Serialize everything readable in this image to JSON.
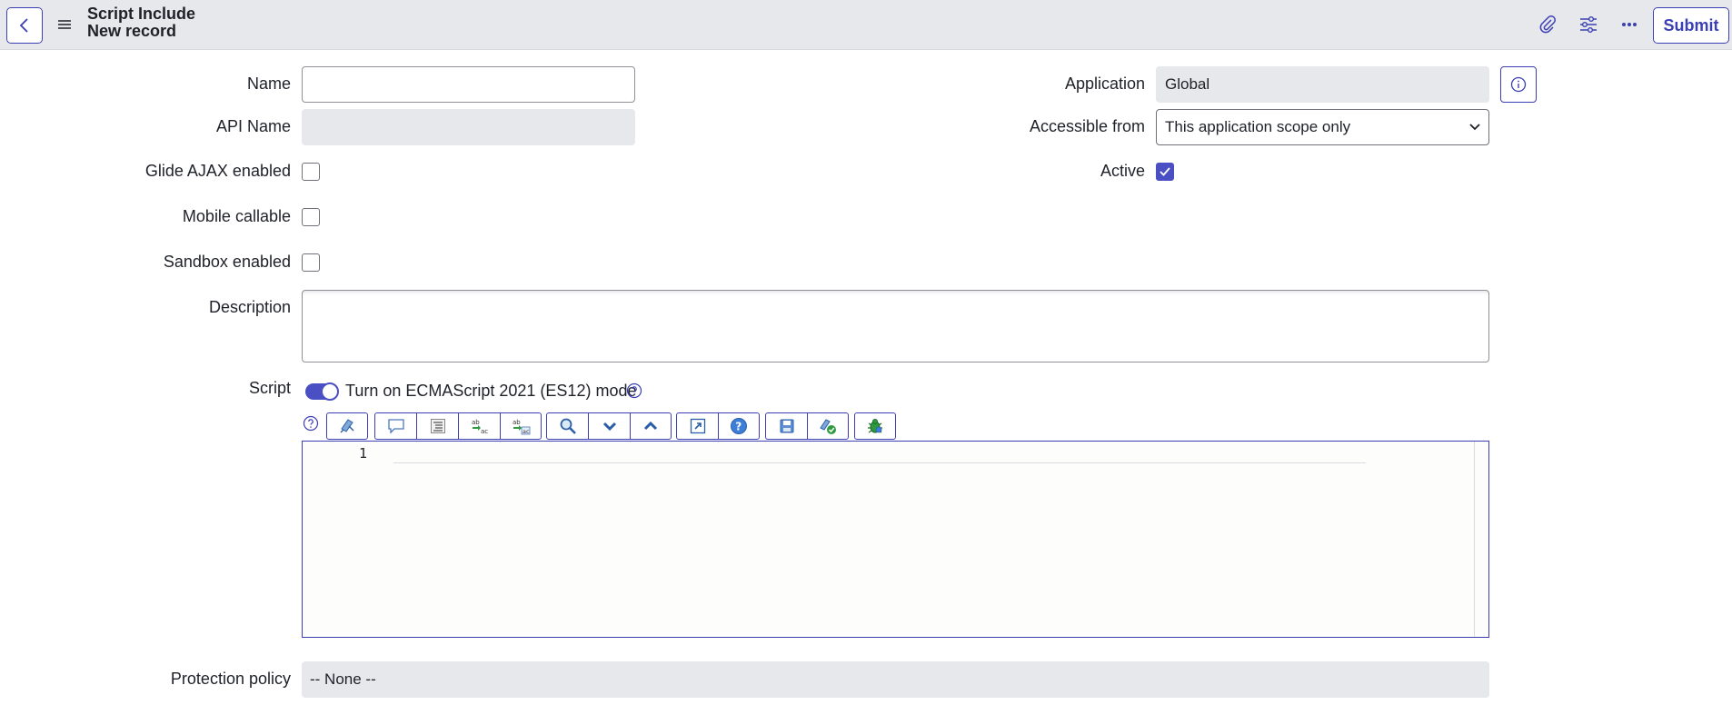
{
  "header": {
    "title": "Script Include",
    "subtitle": "New record",
    "submit_label": "Submit"
  },
  "form": {
    "name": {
      "label": "Name",
      "value": ""
    },
    "api_name": {
      "label": "API Name",
      "value": ""
    },
    "glide_ajax": {
      "label": "Glide AJAX enabled",
      "checked": false
    },
    "mobile_callable": {
      "label": "Mobile callable",
      "checked": false
    },
    "sandbox_enabled": {
      "label": "Sandbox enabled",
      "checked": false
    },
    "description": {
      "label": "Description",
      "value": ""
    },
    "application": {
      "label": "Application",
      "value": "Global"
    },
    "accessible_from": {
      "label": "Accessible from",
      "value": "This application scope only"
    },
    "active": {
      "label": "Active",
      "checked": true
    },
    "script": {
      "label": "Script",
      "es_toggle_label": "Turn on ECMAScript 2021 (ES12) mode",
      "es_toggle_on": true,
      "line_number": "1"
    },
    "protection_policy": {
      "label": "Protection policy",
      "value": "-- None --"
    }
  },
  "toolbar_icons": [
    [
      "toggle-syntax-editor-icon"
    ],
    [
      "comment-selected-code-icon",
      "format-code-icon",
      "replace-icon",
      "replace-all-icon"
    ],
    [
      "search-icon",
      "find-next-icon",
      "find-previous-icon"
    ],
    [
      "fullscreen-icon",
      "help-icon"
    ],
    [
      "save-icon",
      "script-validation-icon"
    ],
    [
      "script-debugger-icon"
    ]
  ],
  "colors": {
    "accent": "#3b3fb3",
    "header_bg": "#e6e8eb",
    "readonly_bg": "#e6e8eb",
    "checkbox_checked": "#4b4fc4"
  }
}
